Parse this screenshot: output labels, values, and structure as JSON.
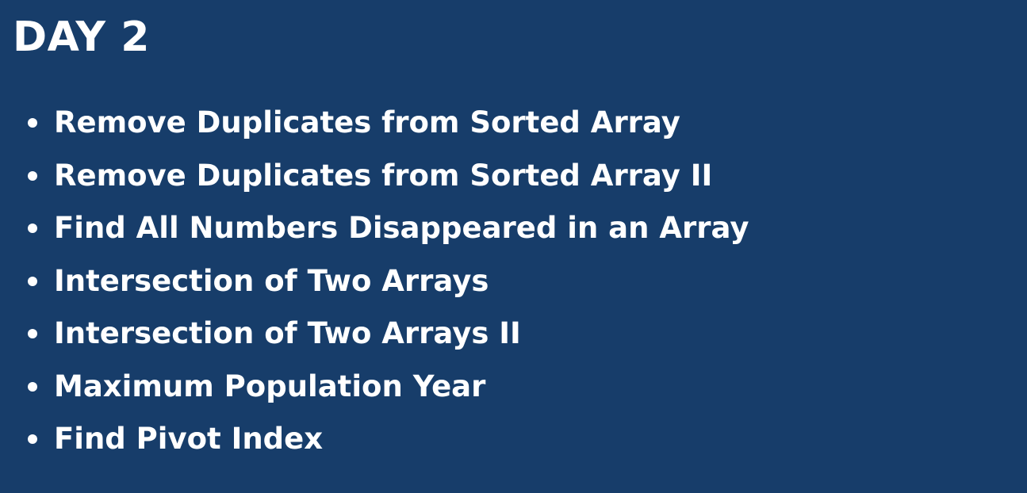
{
  "slide": {
    "title": "DAY 2",
    "background_color": "#173d6a",
    "text_color": "#ffffff",
    "items": [
      {
        "label": "Remove Duplicates from Sorted Array"
      },
      {
        "label": "Remove Duplicates from Sorted Array II"
      },
      {
        "label": "Find All Numbers Disappeared in an Array"
      },
      {
        "label": "Intersection of Two Arrays"
      },
      {
        "label": "Intersection of Two Arrays II"
      },
      {
        "label": "Maximum Population Year"
      },
      {
        "label": "Find Pivot Index"
      }
    ]
  }
}
